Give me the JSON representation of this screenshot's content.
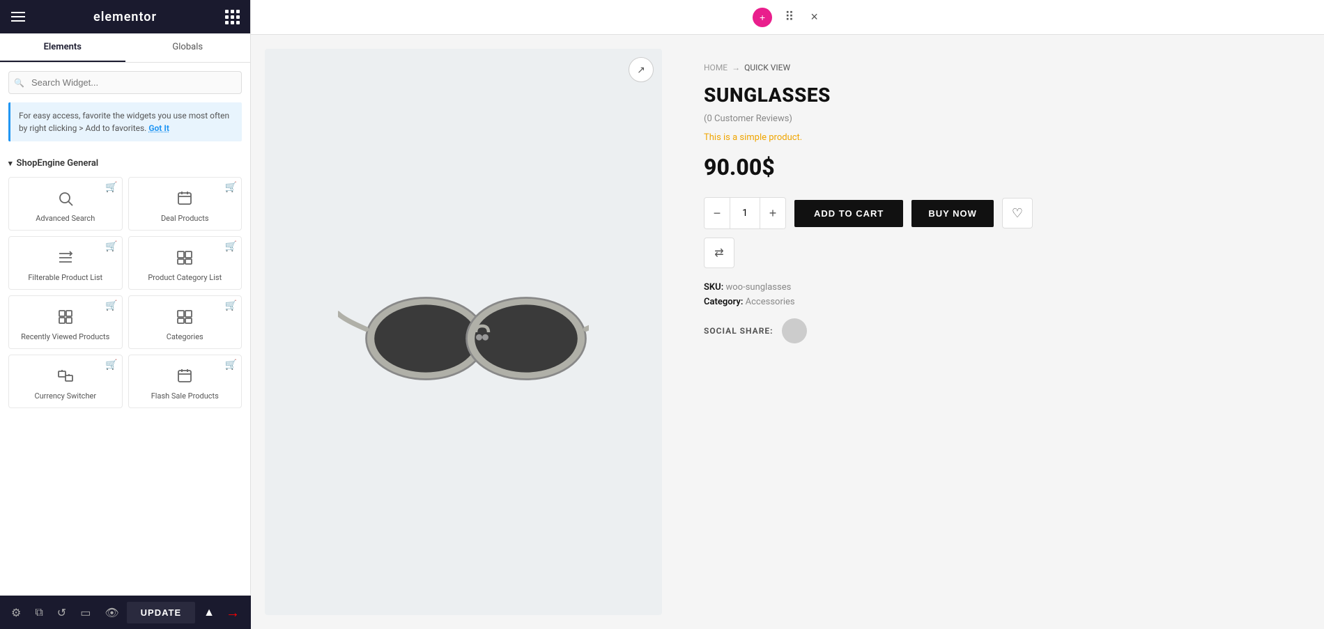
{
  "sidebar": {
    "header": {
      "title": "elementor",
      "menu_icon": "hamburger",
      "grid_icon": "grid"
    },
    "tabs": [
      {
        "label": "Elements",
        "active": true
      },
      {
        "label": "Globals",
        "active": false
      }
    ],
    "search": {
      "placeholder": "Search Widget..."
    },
    "info_box": {
      "text": "For easy access, favorite the widgets you use most often by right clicking > Add to favorites.",
      "link_text": "Got It"
    },
    "section_title": "ShopEngine General",
    "widgets": [
      {
        "id": "advanced-search",
        "icon": "🔍",
        "label": "Advanced Search"
      },
      {
        "id": "deal-products",
        "icon": "🗃",
        "label": "Deal Products"
      },
      {
        "id": "filterable-product-list",
        "icon": "≡↓",
        "label": "Filterable Product List"
      },
      {
        "id": "product-category-list",
        "icon": "🗃",
        "label": "Product Category List"
      },
      {
        "id": "recently-viewed-products",
        "icon": "⧉",
        "label": "Recently Viewed Products"
      },
      {
        "id": "categories",
        "icon": "🗃",
        "label": "Categories"
      },
      {
        "id": "currency-switcher",
        "icon": "⊞",
        "label": "Currency Switcher"
      },
      {
        "id": "flash-sale-products",
        "icon": "🗃",
        "label": "Flash Sale Products"
      }
    ]
  },
  "bottom_bar": {
    "icons": [
      "gear",
      "layers",
      "history",
      "responsive",
      "eye"
    ],
    "update_label": "UPDATE",
    "chevron_up": "▲"
  },
  "toolbar": {
    "add_icon": "+",
    "move_icon": "⠿",
    "close_icon": "×"
  },
  "product": {
    "breadcrumb": {
      "home": "HOME",
      "arrow": "→",
      "current": "QUICK VIEW"
    },
    "title": "SUNGLASSES",
    "reviews": "(0 Customer Reviews)",
    "description": "This is a simple product.",
    "price": "90.00$",
    "quantity": 1,
    "buttons": {
      "add_to_cart": "ADD TO CART",
      "buy_now": "BUY NOW"
    },
    "sku_label": "SKU:",
    "sku_value": "woo-sunglasses",
    "category_label": "Category:",
    "category_value": "Accessories",
    "social_share_label": "SOCIAL SHARE:"
  }
}
